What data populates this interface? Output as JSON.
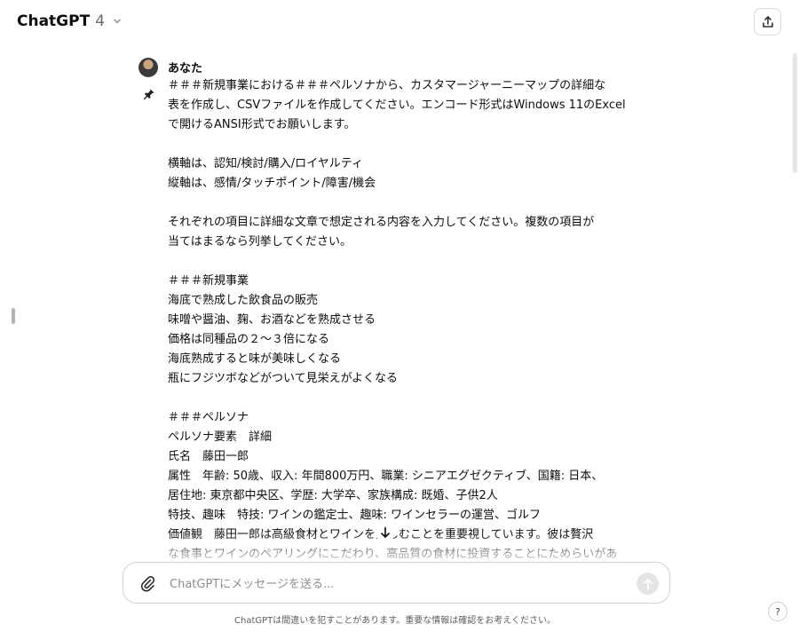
{
  "header": {
    "model_name": "ChatGPT",
    "model_version": "4"
  },
  "message": {
    "author": "あなた",
    "lines": [
      "＃＃＃新規事業における＃＃＃ペルソナから、カスタマージャーニーマップの詳細な",
      "表を作成し、CSVファイルを作成してください。エンコード形式はWindows 11のExcel",
      "で開けるANSI形式でお願いします。",
      "",
      "横軸は、認知/検討/購入/ロイヤルティ",
      "縦軸は、感情/タッチポイント/障害/機会",
      "",
      "それぞれの項目に詳細な文章で想定される内容を入力してください。複数の項目が",
      "当てはまるなら列挙してください。",
      "",
      "＃＃＃新規事業",
      "海底で熟成した飲食品の販売",
      "味噌や醤油、麹、お酒などを熟成させる",
      "価格は同種品の２～３倍になる",
      "海底熟成すると味が美味しくなる",
      "瓶にフジツボなどがついて見栄えがよくなる",
      "",
      "＃＃＃ペルソナ",
      "ペルソナ要素　詳細",
      "氏名　藤田一郎",
      "属性　年齢: 50歳、収入: 年間800万円、職業: シニアエグゼクティブ、国籍: 日本、",
      "居住地: 東京都中央区、学歴: 大学卒、家族構成: 既婚、子供2人",
      "特技、趣味　特技: ワインの鑑定士、趣味: ワインセラーの運営、ゴルフ",
      "価値観　藤田一郎は高級食材とワインを楽しむことを重要視しています。彼は贅沢",
      "な食事とワインのペアリングにこだわり、高品質の食材に投資することにためらいがあ"
    ]
  },
  "composer": {
    "placeholder": "ChatGPTにメッセージを送る..."
  },
  "footer": {
    "disclaimer": "ChatGPTは間違いを犯すことがあります。重要な情報は確認をお考えください。",
    "help_label": "?"
  }
}
